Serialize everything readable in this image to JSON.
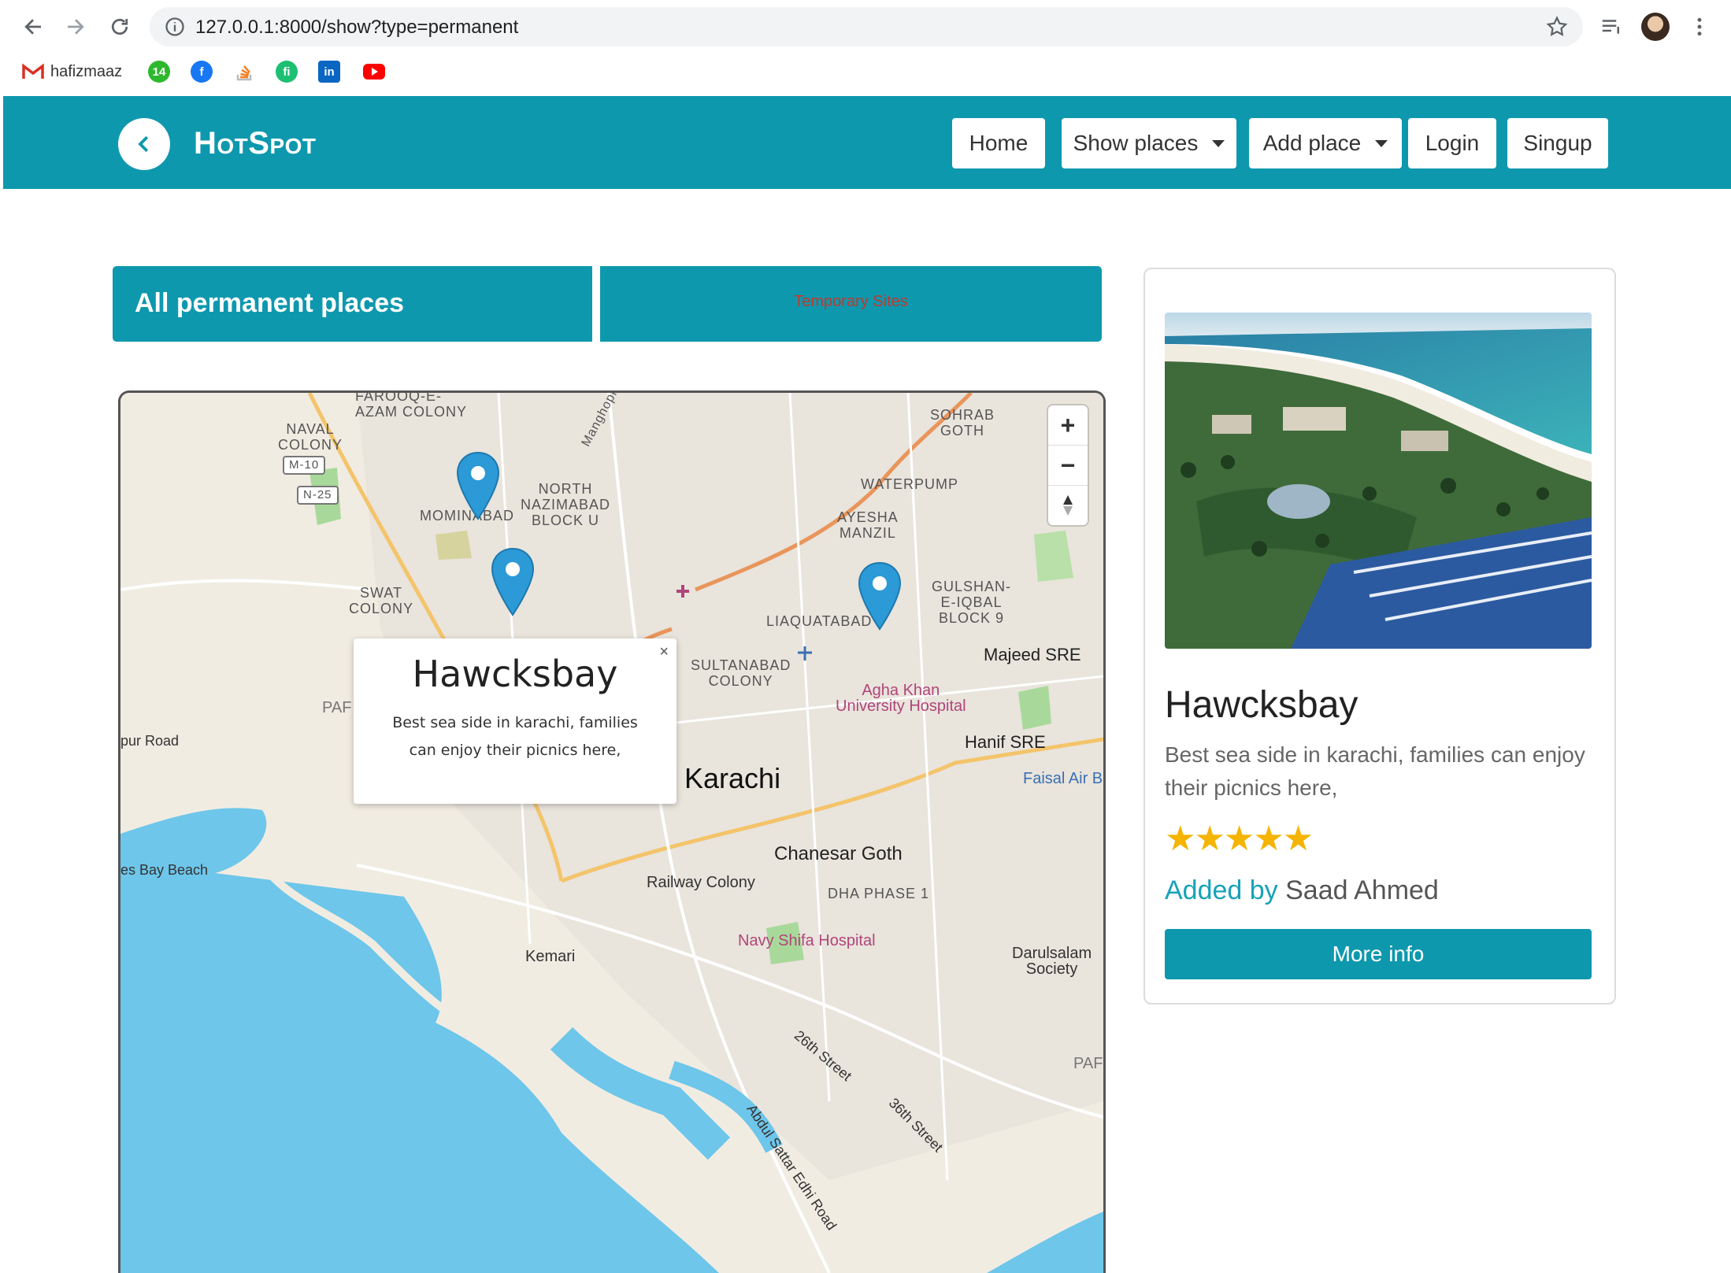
{
  "browser": {
    "url": "127.0.0.1:8000/show?type=permanent",
    "bookmarks": [
      {
        "label": "hafizmaaz",
        "icon": "gmail-icon"
      },
      {
        "label": "",
        "icon": "badge-icon"
      },
      {
        "label": "",
        "icon": "facebook-icon"
      },
      {
        "label": "",
        "icon": "stackoverflow-icon"
      },
      {
        "label": "",
        "icon": "fiverr-icon"
      },
      {
        "label": "",
        "icon": "linkedin-icon"
      },
      {
        "label": "",
        "icon": "youtube-icon"
      }
    ]
  },
  "navbar": {
    "brand": "HotSpot",
    "links": {
      "home": "Home",
      "show_places": "Show places",
      "add_place": "Add place",
      "login": "Login",
      "signup": "Singup"
    }
  },
  "tabs": {
    "active": "All permanent places",
    "inactive": "Temporary Sites"
  },
  "map": {
    "labels": {
      "farooq_azam": "FAROOQ-E-\nAZAM COLONY",
      "naval_colony": "NAVAL\nCOLONY",
      "m10": "M-10",
      "n25": "N-25",
      "mominabad": "MOMINABAD",
      "north_nazimabad": "NORTH\nNAZIMABAD\nBLOCK U",
      "manghopir": "Manghopir",
      "sohrab_goth": "SOHRAB\nGOTH",
      "waterpump": "WATERPUMP",
      "ayesha_manzil": "AYESHA\nMANZIL",
      "gulshan": "GULSHAN-\nE-IQBAL\nBLOCK 9",
      "swat_colony": "SWAT\nCOLONY",
      "liaquatabad": "LIAQUATABAD",
      "majeed_sre": "Majeed SRE",
      "sultanabad": "SULTANABAD\nCOLONY",
      "aga_khan": "Agha Khan\nUniversity Hospital",
      "hanif_sre": "Hanif SRE",
      "faisal_air": "Faisal Air B",
      "paf1": "PAF",
      "pur_road": "pur Road",
      "karachi": "Karachi",
      "bay_beach": "es Bay Beach",
      "chanesar_goth": "Chanesar Goth",
      "railway_colony": "Railway Colony",
      "dha_phase": "DHA PHASE 1",
      "navy_shifa": "Navy Shifa Hospital",
      "kemari": "Kemari",
      "darulsalam": "Darulsalam\nSociety",
      "street26": "26th Street",
      "abdul_sattar": "Abdul Sattar Edhi Road",
      "street36": "36th Street",
      "paf2": "PAF"
    },
    "zoom_in": "+",
    "zoom_out": "−",
    "compass": "▲",
    "popup": {
      "title": "Hawcksbay",
      "description": "Best sea side in karachi, families can enjoy their picnics here,",
      "close": "×"
    }
  },
  "card": {
    "title": "Hawcksbay",
    "description": "Best sea side in karachi, families can enjoy their picnics here,",
    "rating": 5,
    "stars": "★★★★★",
    "added_by_label": "Added by",
    "added_by_name": "Saad Ahmed",
    "button": "More info"
  },
  "colors": {
    "primary": "#0e98ae",
    "water": "#6ec6ea",
    "star": "#f5b400",
    "tab_inactive_text": "#c0392b"
  }
}
